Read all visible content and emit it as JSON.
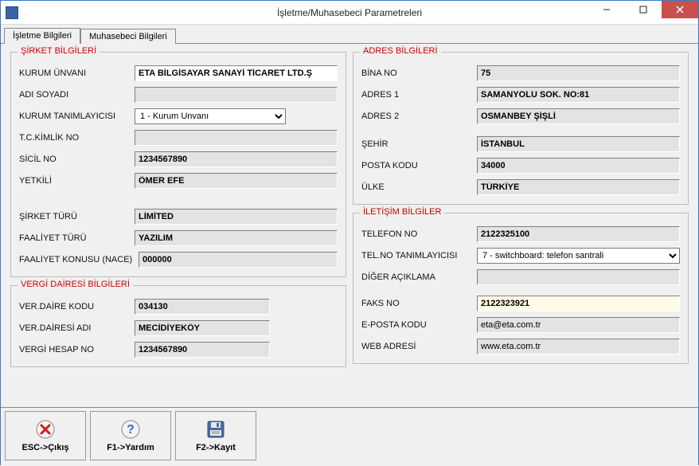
{
  "window": {
    "title": "İşletme/Muhasebeci Parametreleri"
  },
  "tabs": {
    "active": "İşletme Bilgileri",
    "other": "Muhasebeci Bilgileri"
  },
  "groups": {
    "sirket": "ŞİRKET BİLGİLERİ",
    "vergi": "VERGİ DAİRESİ BİLGİLERİ",
    "adres": "ADRES BİLGİLERİ",
    "iletisim": "İLETİŞİM BİLGİLER"
  },
  "labels": {
    "kurum_unvani": "KURUM ÜNVANI",
    "adi_soyadi": "ADI SOYADI",
    "kurum_tanimlayicisi": "KURUM TANIMLAYICISI",
    "tc_kimlik_no": "T.C.KİMLİK NO",
    "sicil_no": "SİCİL NO",
    "yetkili": "YETKİLİ",
    "sirket_turu": "ŞİRKET TÜRÜ",
    "faaliyet_turu": "FAALİYET TÜRÜ",
    "faaliyet_konusu": "FAALİYET KONUSU (NACE)",
    "ver_daire_kodu": "VER.DAİRE KODU",
    "ver_dairesi_adi": "VER.DAİRESİ ADI",
    "vergi_hesap_no": "VERGİ HESAP NO",
    "bina_no": "BİNA NO",
    "adres1": "ADRES 1",
    "adres2": "ADRES 2",
    "sehir": "ŞEHİR",
    "posta_kodu": "POSTA KODU",
    "ulke": "ÜLKE",
    "telefon_no": "TELEFON NO",
    "tel_no_tanimlayicisi": "TEL.NO TANIMLAYICISI",
    "diger_aciklama": "DİĞER AÇIKLAMA",
    "faks_no": "FAKS NO",
    "eposta_kodu": "E-POSTA KODU",
    "web_adresi": "WEB ADRESİ"
  },
  "values": {
    "kurum_unvani": "ETA BİLGİSAYAR SANAYİ TİCARET LTD.Ş",
    "adi_soyadi": "",
    "kurum_tanimlayicisi": "1 - Kurum Unvanı",
    "tc_kimlik_no": "",
    "sicil_no": "1234567890",
    "yetkili": "ÖMER EFE",
    "sirket_turu": "LİMİTED",
    "faaliyet_turu": "YAZILIM",
    "faaliyet_konusu": "000000",
    "ver_daire_kodu": "034130",
    "ver_dairesi_adi": "MECİDİYEKÖY",
    "vergi_hesap_no": "1234567890",
    "bina_no": "75",
    "adres1": "SAMANYOLU SOK. NO:81",
    "adres2": "OSMANBEY ŞİŞLİ",
    "sehir": "İSTANBUL",
    "posta_kodu": "34000",
    "ulke": "TÜRKİYE",
    "telefon_no": "2122325100",
    "tel_no_tanimlayicisi": "7 - switchboard: telefon santrali",
    "diger_aciklama": "",
    "faks_no": "2122323921",
    "eposta_kodu": "eta@eta.com.tr",
    "web_adresi": "www.eta.com.tr"
  },
  "buttons": {
    "esc": "ESC->Çıkış",
    "f1": "F1->Yardım",
    "f2": "F2->Kayıt"
  }
}
